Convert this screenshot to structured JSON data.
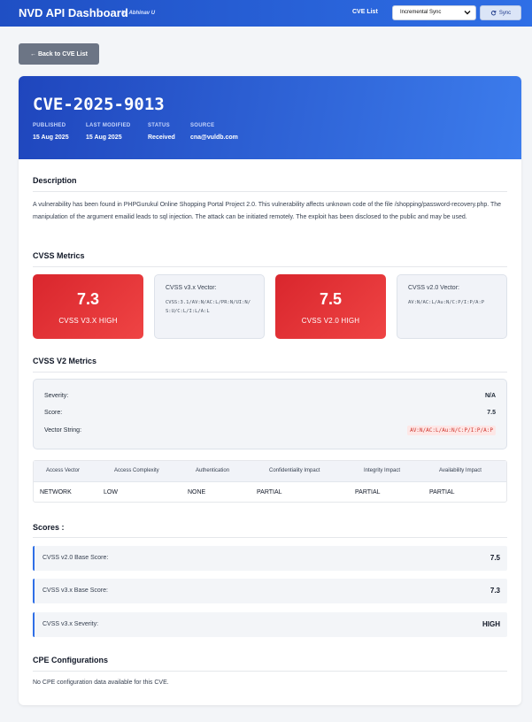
{
  "header": {
    "title": "NVD API Dashboard",
    "by": "by Abhinav U",
    "nav_cve_list": "CVE List",
    "sync_mode": "Incremental Sync",
    "sync_label": "Sync"
  },
  "back_label": "← Back to CVE List",
  "cve": {
    "id": "CVE-2025-9013",
    "meta": [
      {
        "key": "PUBLISHED",
        "value": "15 Aug 2025"
      },
      {
        "key": "LAST MODIFIED",
        "value": "15 Aug 2025"
      },
      {
        "key": "STATUS",
        "value": "Received"
      },
      {
        "key": "SOURCE",
        "value": "cna@vuldb.com"
      }
    ]
  },
  "description": {
    "title": "Description",
    "text": "A vulnerability has been found in PHPGurukul Online Shopping Portal Project 2.0. This vulnerability affects unknown code of the file /shopping/password-recovery.php. The manipulation of the argument emailid leads to sql injection. The attack can be initiated remotely. The exploit has been disclosed to the public and may be used."
  },
  "cvss_metrics": {
    "title": "CVSS Metrics",
    "v3_score": "7.3",
    "v3_label": "CVSS V3.X HIGH",
    "v3_vector_title": "CVSS v3.x Vector:",
    "v3_vector": "CVSS:3.1/AV:N/AC:L/PR:N/UI:N/S:U/C:L/I:L/A:L",
    "v2_score": "7.5",
    "v2_label": "CVSS V2.0 HIGH",
    "v2_vector_title": "CVSS v2.0 Vector:",
    "v2_vector": "AV:N/AC:L/Au:N/C:P/I:P/A:P",
    "colors": {
      "high": "#dc2626"
    }
  },
  "v2_metrics": {
    "title": "CVSS V2 Metrics",
    "severity_label": "Severity:",
    "severity_value": "N/A",
    "score_label": "Score:",
    "score_value": "7.5",
    "vector_label": "Vector String:",
    "vector_value": "AV:N/AC:L/Au:N/C:P/I:P/A:P",
    "table": {
      "headers": [
        "Access Vector",
        "Access Complexity",
        "Authentication",
        "Confidentiality Impact",
        "Integrity Impact",
        "Availability Impact"
      ],
      "row": [
        "NETWORK",
        "LOW",
        "NONE",
        "PARTIAL",
        "PARTIAL",
        "PARTIAL"
      ]
    }
  },
  "scores": {
    "title": "Scores :",
    "items": [
      {
        "label": "CVSS v2.0 Base Score:",
        "value": "7.5"
      },
      {
        "label": "CVSS v3.x Base Score:",
        "value": "7.3"
      },
      {
        "label": "CVSS v3.x Severity:",
        "value": "HIGH"
      }
    ]
  },
  "cpe": {
    "title": "CPE Configurations",
    "note": "No CPE configuration data available for this CVE."
  }
}
